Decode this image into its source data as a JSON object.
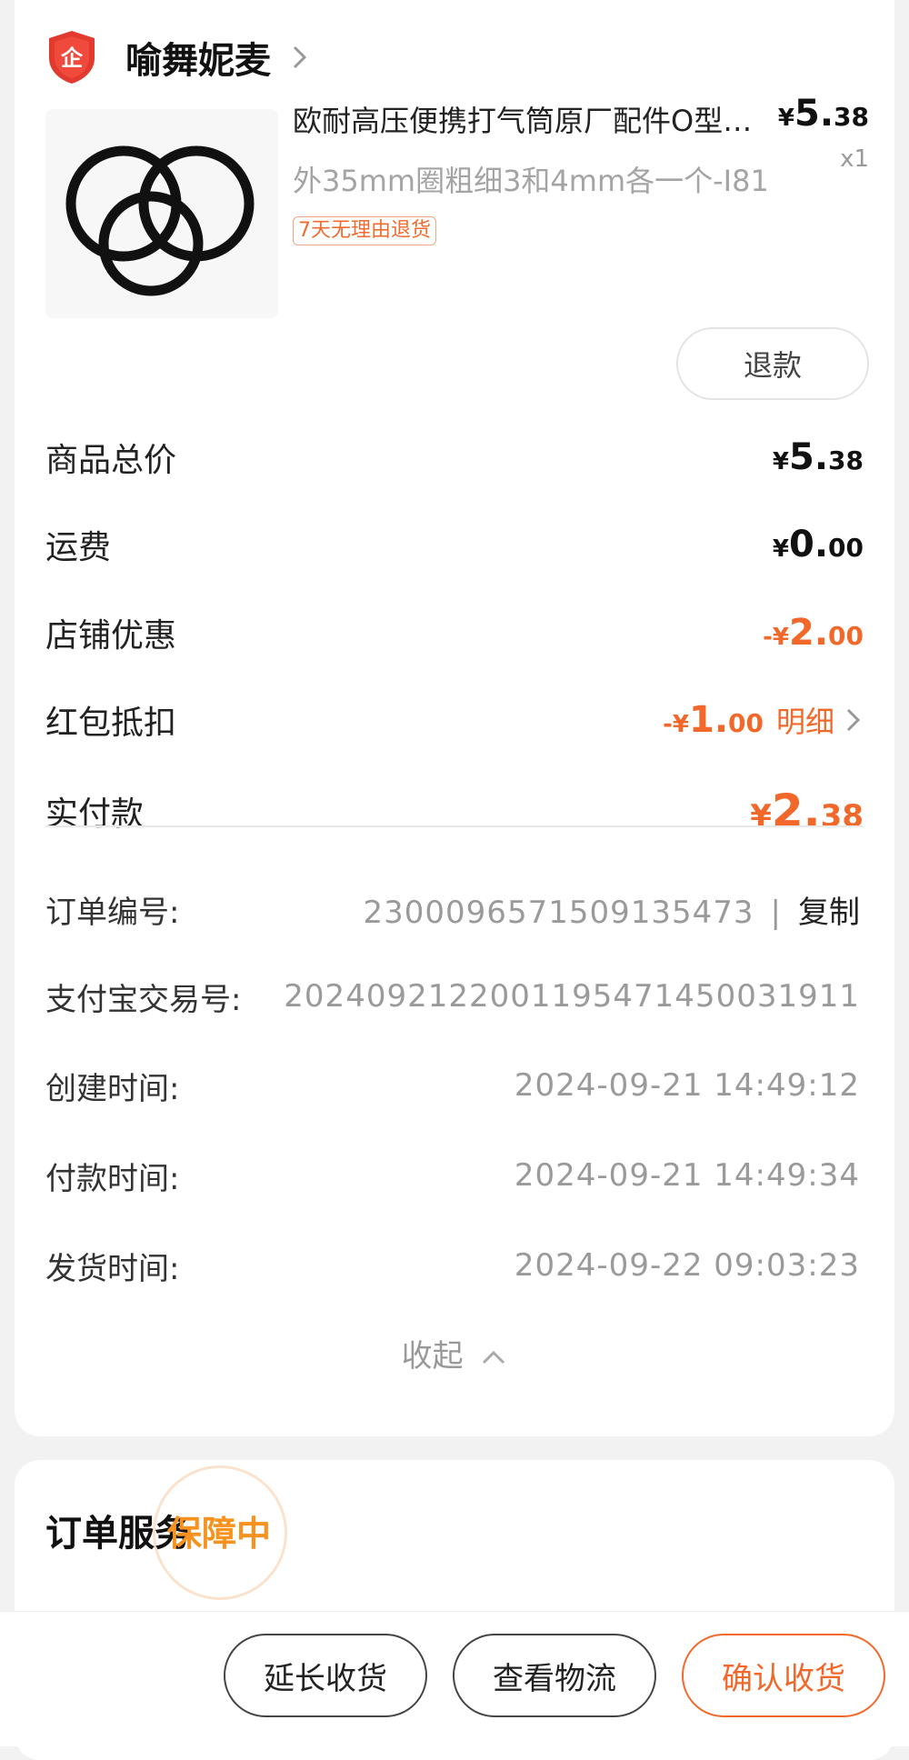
{
  "shop": {
    "name": "喻舞妮麦",
    "badge_char": "企"
  },
  "product": {
    "title": "欧耐高压便携打气筒原厂配件O型圈…",
    "spec": "外35mm圈粗细3和4mm各一个-I81",
    "tag": "7天无理由退货",
    "price": {
      "yen": "¥",
      "int": "5.",
      "dec": "38"
    },
    "qty": "x1",
    "refund_label": "退款"
  },
  "summary": {
    "goods_total": {
      "label": "商品总价",
      "yen": "¥",
      "int": "5.",
      "dec": "38"
    },
    "shipping": {
      "label": "运费",
      "yen": "¥",
      "int": "0.",
      "dec": "00"
    },
    "shop_discount": {
      "label": "店铺优惠",
      "yen": "-¥",
      "int": "2.",
      "dec": "00"
    },
    "red_packet": {
      "label": "红包抵扣",
      "yen": "-¥",
      "int": "1.",
      "dec": "00",
      "detail": "明细"
    },
    "paid": {
      "label": "实付款",
      "yen": "¥",
      "int": "2.",
      "dec": "38"
    }
  },
  "info": {
    "order_no": {
      "label": "订单编号:",
      "value": "2300096571509135473",
      "sep": "|",
      "copy": "复制"
    },
    "alipay_no": {
      "label": "支付宝交易号:",
      "value": "2024092122001195471450031911"
    },
    "created": {
      "label": "创建时间:",
      "value": "2024-09-21 14:49:12"
    },
    "paid_time": {
      "label": "付款时间:",
      "value": "2024-09-21 14:49:34"
    },
    "shipped": {
      "label": "发货时间:",
      "value": "2024-09-22 09:03:23"
    }
  },
  "collapse_label": "收起",
  "service": {
    "title": "订单服务",
    "status": "保障中"
  },
  "actions": {
    "extend": "延长收货",
    "logistics": "查看物流",
    "confirm": "确认收货"
  },
  "colors": {
    "accent": "#f2682a",
    "service_orange": "#f7921e",
    "badge_red": "#e23a2e"
  }
}
